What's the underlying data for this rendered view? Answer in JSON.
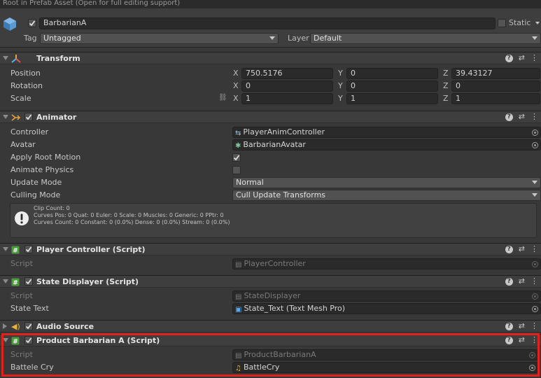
{
  "banner": "Root in Prefab Asset (Open for full editing support)",
  "gameobject": {
    "name": "BarbarianA",
    "static_label": "Static",
    "tag_label": "Tag",
    "tag_value": "Untagged",
    "layer_label": "Layer",
    "layer_value": "Default"
  },
  "transform": {
    "title": "Transform",
    "rows": [
      {
        "label": "Position",
        "x": "750.5176",
        "y": "0",
        "z": "39.43127"
      },
      {
        "label": "Rotation",
        "x": "0",
        "y": "0",
        "z": "0"
      },
      {
        "label": "Scale",
        "x": "1",
        "y": "1",
        "z": "1"
      }
    ],
    "axes": {
      "x": "X",
      "y": "Y",
      "z": "Z"
    }
  },
  "animator": {
    "title": "Animator",
    "controller_label": "Controller",
    "controller_value": "PlayerAnimController",
    "avatar_label": "Avatar",
    "avatar_value": "BarbarianAvatar",
    "apply_root_motion_label": "Apply Root Motion",
    "apply_root_motion": true,
    "animate_physics_label": "Animate Physics",
    "animate_physics": false,
    "update_mode_label": "Update Mode",
    "update_mode_value": "Normal",
    "culling_mode_label": "Culling Mode",
    "culling_mode_value": "Cull Update Transforms",
    "info": [
      "Clip Count: 0",
      "Curves Pos: 0 Quat: 0 Euler: 0 Scale: 0 Muscles: 0 Generic: 0 PPtr: 0",
      "Curves Count: 0 Constant: 0 (0.0%) Dense: 0 (0.0%) Stream: 0 (0.0%)"
    ]
  },
  "player_controller": {
    "title": "Player Controller (Script)",
    "script_label": "Script",
    "script_value": "PlayerController"
  },
  "state_displayer": {
    "title": "State Displayer (Script)",
    "script_label": "Script",
    "script_value": "StateDisplayer",
    "state_text_label": "State Text",
    "state_text_value": "State_Text (Text Mesh Pro)"
  },
  "audio_source": {
    "title": "Audio Source"
  },
  "product_barbarian": {
    "title": "Product Barbarian A (Script)",
    "script_label": "Script",
    "script_value": "ProductBarbarianA",
    "battle_cry_label": "Battele Cry",
    "battle_cry_value": "BattleCry"
  },
  "colors": {
    "highlight": "#e0221c",
    "background": "#383838",
    "field": "#2a2a2a"
  }
}
